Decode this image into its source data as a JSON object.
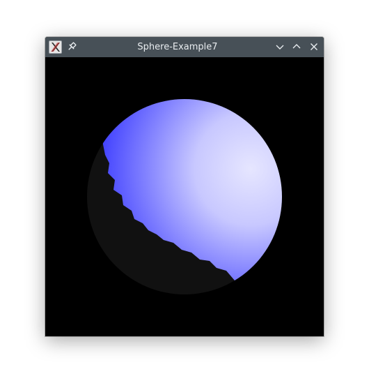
{
  "window": {
    "title": "Sphere-Example7"
  },
  "titlebar": {
    "icons": {
      "app": "x11-app-icon",
      "pin": "pin-icon",
      "minimize": "chevron-down-icon",
      "maximize": "chevron-up-icon",
      "close": "close-icon"
    }
  },
  "scene": {
    "background_color": "#000000",
    "sphere_lit_color": "#3a3aff",
    "sphere_highlight_color": "#e6e6ff",
    "sphere_shadow_color": "#111111"
  }
}
